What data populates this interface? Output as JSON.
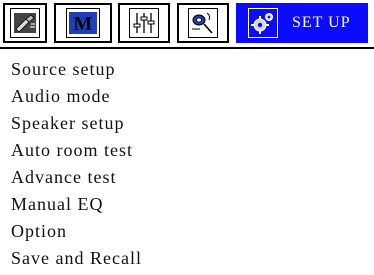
{
  "tabs": [
    {
      "icon": "input-source-icon"
    },
    {
      "icon": "movie-mode-icon",
      "glyph": "M"
    },
    {
      "icon": "equalizer-icon"
    },
    {
      "icon": "speaker-icon"
    },
    {
      "icon": "setup-gear-icon",
      "label": "SET UP",
      "active": true
    }
  ],
  "menu": {
    "items": [
      "Source setup",
      "Audio mode",
      "Speaker setup",
      "Auto room test",
      "Advance test",
      "Manual EQ",
      "Option",
      "Save and Recall"
    ]
  },
  "colors": {
    "active_tab": "#0b0bff",
    "icon_blue": "#1f3fb8"
  }
}
